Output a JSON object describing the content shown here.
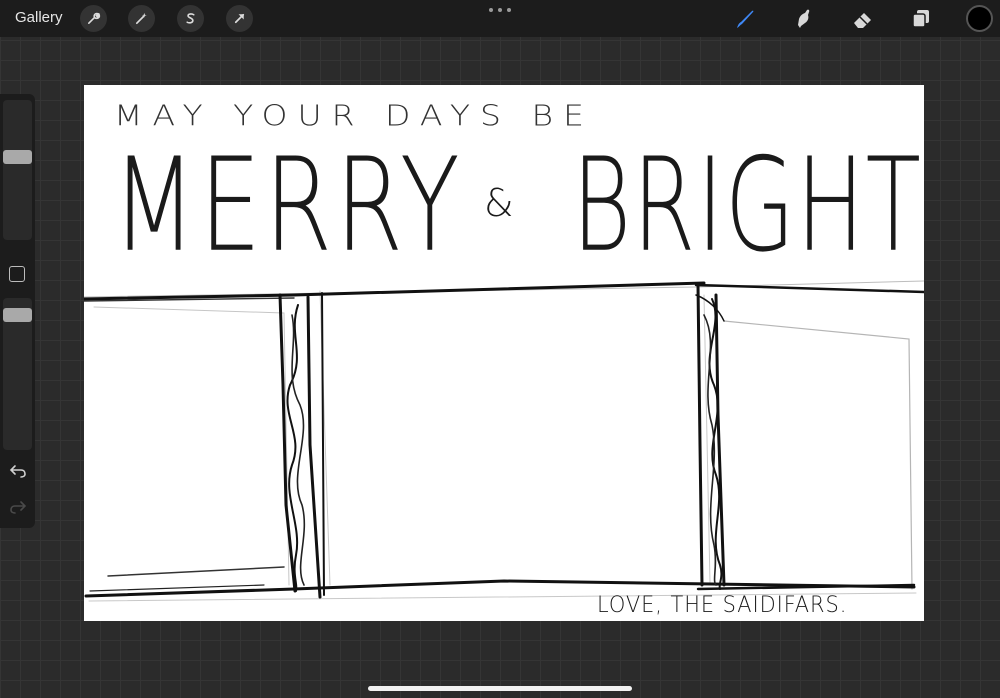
{
  "topbar": {
    "gallery_label": "Gallery",
    "left_tools": [
      "wrench-icon",
      "magic-wand-icon",
      "selection-s-icon",
      "transform-arrow-icon"
    ],
    "right_tools": [
      "brush-icon",
      "smudge-icon",
      "eraser-icon",
      "layers-icon"
    ],
    "active_tool": "brush-icon",
    "accent_color": "#3f88f6",
    "current_color": "#000000"
  },
  "sidebar": {
    "controls": [
      "brush-size-slider",
      "modify-button",
      "opacity-slider",
      "undo-icon",
      "redo-icon"
    ]
  },
  "canvas": {
    "line1": "MAY YOUR DAYS BE",
    "line2a": "MERRY",
    "line2b": "&",
    "line2c": "BRIGHT",
    "signature": "LOVE, THE SAIDIFARS."
  }
}
